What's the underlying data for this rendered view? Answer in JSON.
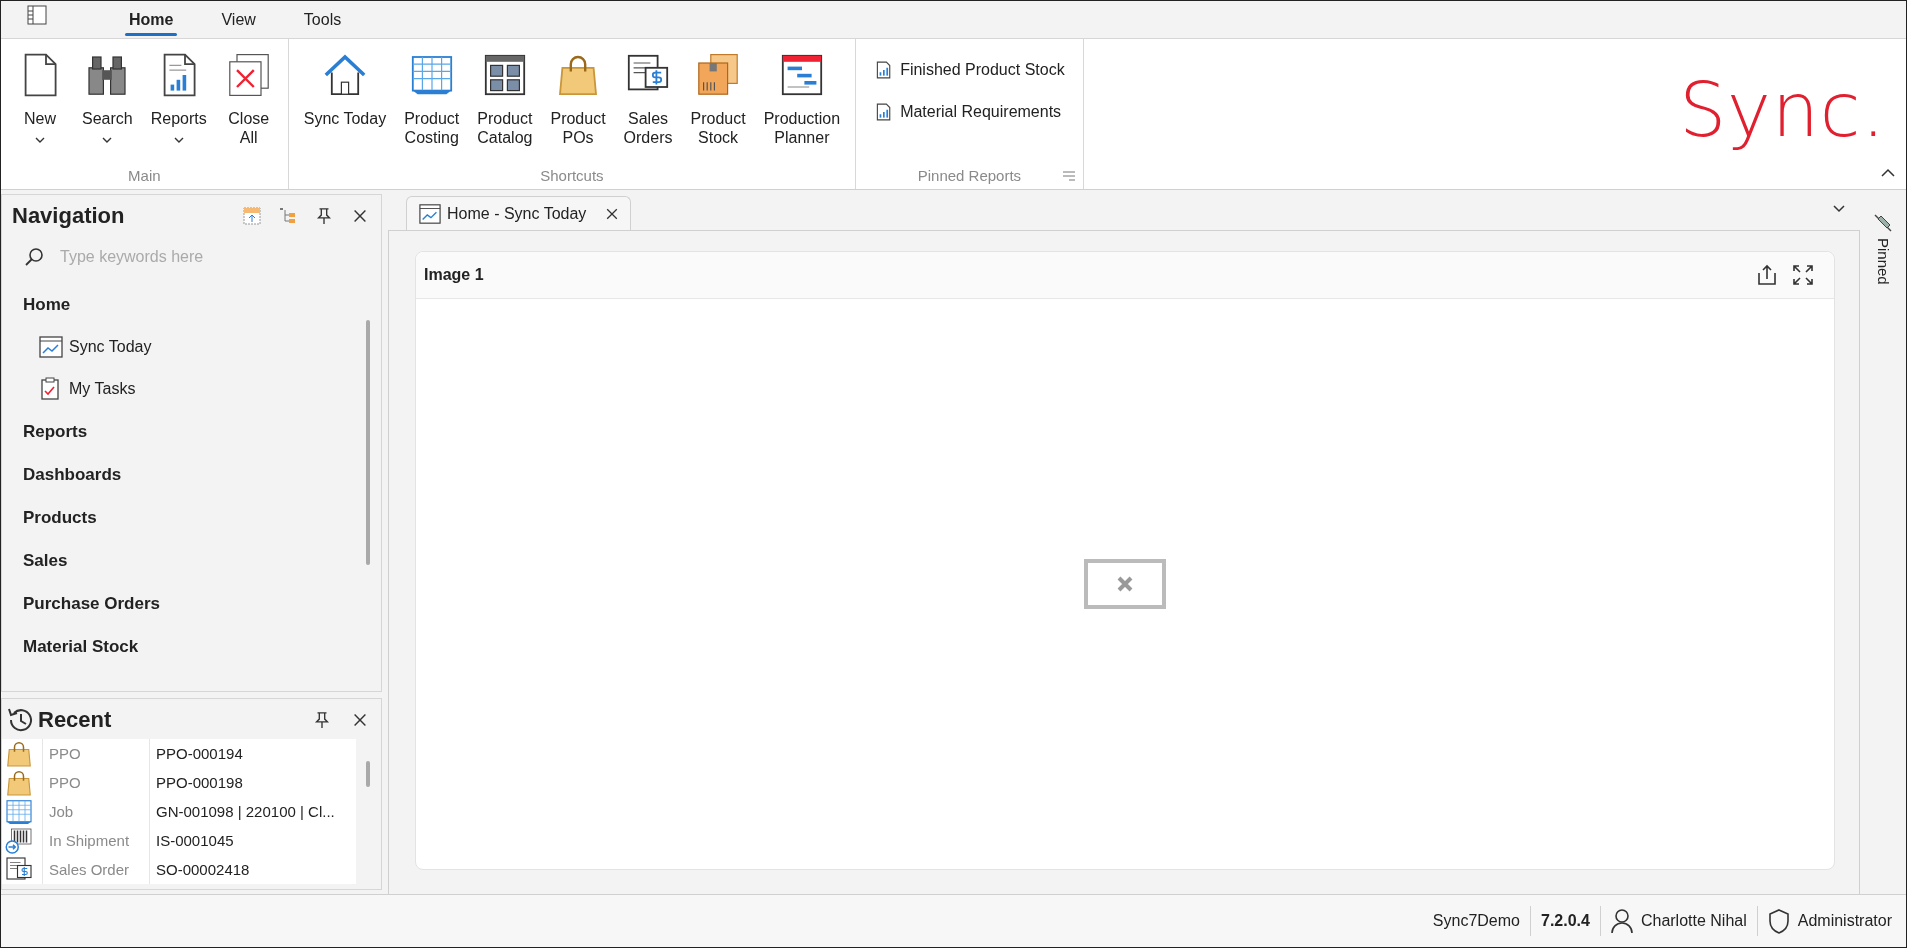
{
  "menu_tabs": [
    {
      "label": "Home",
      "selected": true
    },
    {
      "label": "View",
      "selected": false
    },
    {
      "label": "Tools",
      "selected": false
    }
  ],
  "ribbon": {
    "groups": [
      {
        "title": "Main",
        "kind": "large",
        "items": [
          {
            "label": "New",
            "dropdown": true
          },
          {
            "label": "Search",
            "dropdown": true
          },
          {
            "label": "Reports",
            "dropdown": true
          },
          {
            "label": "Close\nAll",
            "dropdown": false
          }
        ]
      },
      {
        "title": "Shortcuts",
        "kind": "large",
        "items": [
          {
            "label": "Sync Today",
            "dropdown": false
          },
          {
            "label": "Product\nCosting",
            "dropdown": false
          },
          {
            "label": "Product\nCatalog",
            "dropdown": false
          },
          {
            "label": "Product\nPOs",
            "dropdown": false
          },
          {
            "label": "Sales\nOrders",
            "dropdown": false
          },
          {
            "label": "Product\nStock",
            "dropdown": false
          },
          {
            "label": "Production\nPlanner",
            "dropdown": false
          }
        ]
      },
      {
        "title": "Pinned Reports",
        "kind": "list",
        "items": [
          {
            "label": "Finished Product Stock"
          },
          {
            "label": "Material Requirements"
          }
        ]
      }
    ]
  },
  "brand": "Sync.",
  "navigation": {
    "title": "Navigation",
    "search": {
      "placeholder": "Type keywords here"
    },
    "items": [
      {
        "label": "Home",
        "children": [
          {
            "label": "Sync Today"
          },
          {
            "label": "My Tasks"
          }
        ]
      },
      {
        "label": "Reports"
      },
      {
        "label": "Dashboards"
      },
      {
        "label": "Products"
      },
      {
        "label": "Sales"
      },
      {
        "label": "Purchase Orders"
      },
      {
        "label": "Material Stock"
      }
    ]
  },
  "recent": {
    "title": "Recent",
    "rows": [
      {
        "type": "PPO",
        "value": "PPO-000194"
      },
      {
        "type": "PPO",
        "value": "PPO-000198"
      },
      {
        "type": "Job",
        "value": "GN-001098 | 220100 | Cl..."
      },
      {
        "type": "In Shipment",
        "value": "IS-0001045"
      },
      {
        "type": "Sales Order",
        "value": "SO-00002418"
      }
    ]
  },
  "document_tabs": [
    {
      "label": "Home - Sync Today"
    }
  ],
  "panel": {
    "title": "Image 1"
  },
  "side_pin": {
    "label": "Pinned"
  },
  "status_bar": [
    {
      "kind": "text",
      "text": "Sync7Demo"
    },
    {
      "kind": "bold",
      "text": "7.2.0.4"
    },
    {
      "kind": "user",
      "text": "Charlotte Nihal"
    },
    {
      "kind": "role",
      "text": "Administrator"
    }
  ]
}
